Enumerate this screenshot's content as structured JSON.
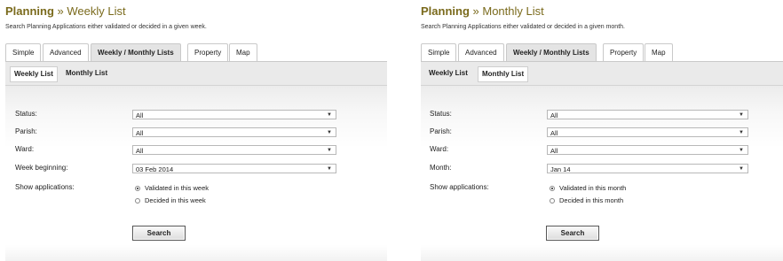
{
  "weekly": {
    "title_brand": "Planning",
    "title_sep": "»",
    "title_sub": "Weekly List",
    "description": "Search Planning Applications either validated or decided in a given week.",
    "tabs": [
      {
        "label": "Simple"
      },
      {
        "label": "Advanced"
      },
      {
        "label": "Weekly / Monthly Lists",
        "active": true
      },
      {
        "label": "Property"
      },
      {
        "label": "Map"
      }
    ],
    "subtabs": [
      {
        "label": "Weekly List",
        "active": true
      },
      {
        "label": "Monthly List"
      }
    ],
    "fields": {
      "status_label": "Status:",
      "status_value": "All",
      "parish_label": "Parish:",
      "parish_value": "All",
      "ward_label": "Ward:",
      "ward_value": "All",
      "period_label": "Week beginning:",
      "period_value": "03 Feb 2014",
      "show_label": "Show applications:"
    },
    "radios": [
      {
        "label": "Validated in this week",
        "checked": true
      },
      {
        "label": "Decided in this week",
        "checked": false
      }
    ],
    "search_label": "Search"
  },
  "monthly": {
    "title_brand": "Planning",
    "title_sep": "»",
    "title_sub": "Monthly List",
    "description": "Search Planning Applications either validated or decided in a given month.",
    "tabs": [
      {
        "label": "Simple"
      },
      {
        "label": "Advanced"
      },
      {
        "label": "Weekly / Monthly Lists",
        "active": true
      },
      {
        "label": "Property"
      },
      {
        "label": "Map"
      }
    ],
    "subtabs": [
      {
        "label": "Weekly List"
      },
      {
        "label": "Monthly List",
        "active": true
      }
    ],
    "fields": {
      "status_label": "Status:",
      "status_value": "All",
      "parish_label": "Parish:",
      "parish_value": "All",
      "ward_label": "Ward:",
      "ward_value": "All",
      "period_label": "Month:",
      "period_value": "Jan 14",
      "show_label": "Show applications:"
    },
    "radios": [
      {
        "label": "Validated in this month",
        "checked": true
      },
      {
        "label": "Decided in this month",
        "checked": false
      }
    ],
    "search_label": "Search"
  },
  "colors": {
    "brand": "#7a6a1c",
    "active_tab": "#e4e4e4"
  }
}
